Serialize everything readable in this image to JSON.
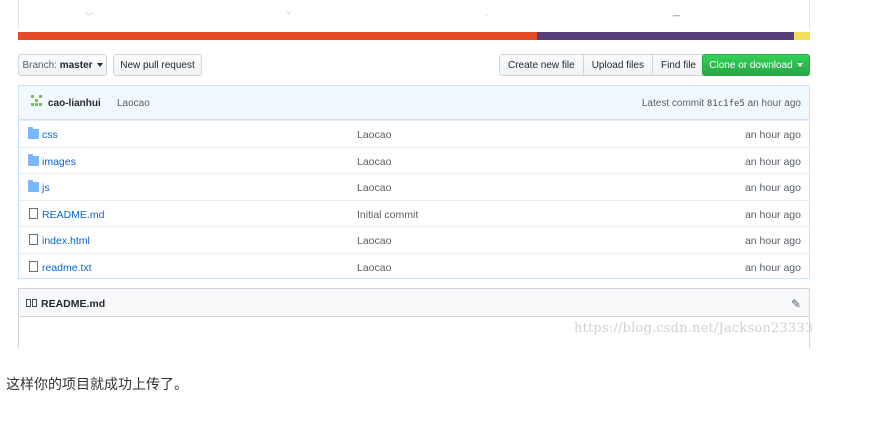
{
  "colors": {
    "lang_bar": [
      "#e34c26",
      "#563d7c",
      "#f1e05a"
    ],
    "clone_button": "#28a745",
    "link": "#0366d6"
  },
  "lang_bar_fractions": [
    0.655,
    0.325,
    0.02
  ],
  "toolbar": {
    "branch_prefix": "Branch:",
    "branch_name": "master",
    "new_pull_request": "New pull request",
    "create_new_file": "Create new file",
    "upload_files": "Upload files",
    "find_file": "Find file",
    "clone_or_download": "Clone or download"
  },
  "commit": {
    "author": "cao-lianhui",
    "message": "Laocao",
    "latest_label": "Latest commit",
    "sha": "81c1fe5",
    "time": "an hour ago"
  },
  "files": [
    {
      "type": "folder",
      "icon": "folder-icon",
      "name": "css",
      "message": "Laocao",
      "age": "an hour ago"
    },
    {
      "type": "folder",
      "icon": "folder-icon",
      "name": "images",
      "message": "Laocao",
      "age": "an hour ago"
    },
    {
      "type": "folder",
      "icon": "folder-icon",
      "name": "js",
      "message": "Laocao",
      "age": "an hour ago"
    },
    {
      "type": "file",
      "icon": "file-icon",
      "name": "README.md",
      "message": "Initial commit",
      "age": "an hour ago"
    },
    {
      "type": "file",
      "icon": "file-icon",
      "name": "index.html",
      "message": "Laocao",
      "age": "an hour ago"
    },
    {
      "type": "file",
      "icon": "file-icon",
      "name": "readme.txt",
      "message": "Laocao",
      "age": "an hour ago"
    }
  ],
  "readme": {
    "title": "README.md",
    "edit_icon": "pencil-icon",
    "book_icon": "book-icon"
  },
  "watermark": "https://blog.csdn.net/Jackson23333",
  "caption": "这样你的项目就成功上传了。"
}
